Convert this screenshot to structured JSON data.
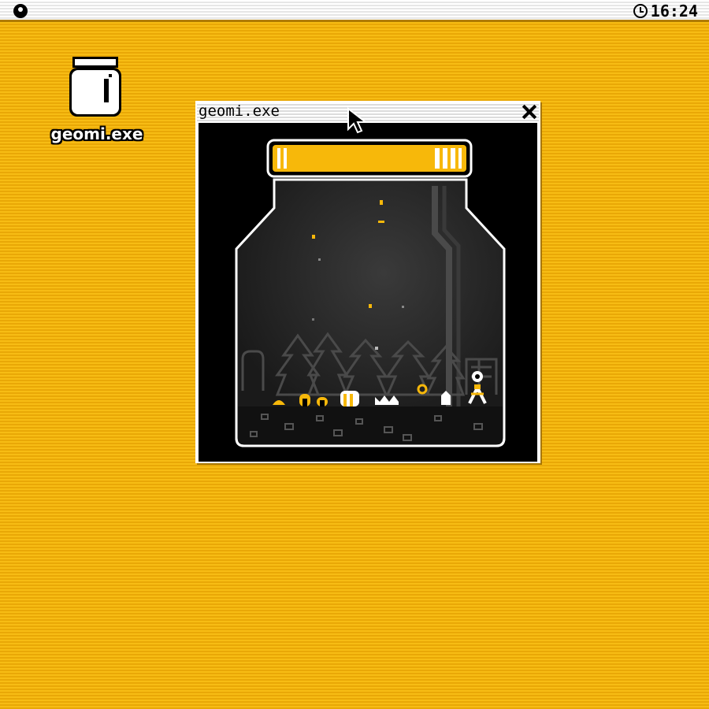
{
  "menubar": {
    "clock_time": "16:24",
    "apple_icon": "apple-menu-icon",
    "clock_icon": "clock-icon"
  },
  "desktop": {
    "icons": [
      {
        "label": "geomi.exe",
        "icon": "jar-icon"
      }
    ],
    "background_color": "#f5b60a"
  },
  "window": {
    "title": "geomi.exe",
    "close_icon": "close-icon",
    "content": "terrarium-jar-scene"
  },
  "colors": {
    "accent": "#f5b60a",
    "lid": "#f7b80a",
    "jar_outline": "#ffffff",
    "scene_bg": "#000000"
  }
}
